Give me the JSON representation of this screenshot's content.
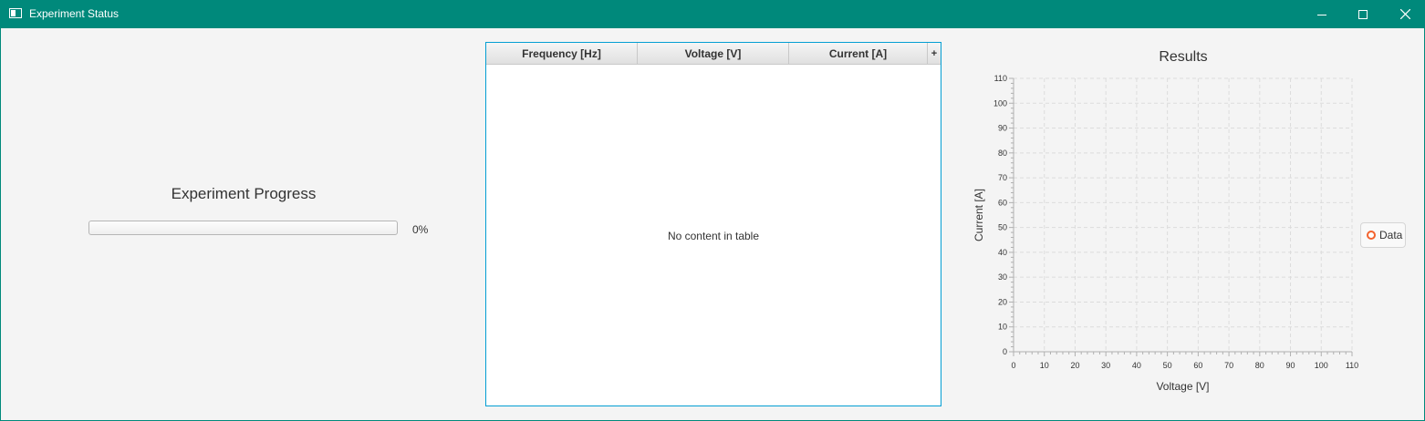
{
  "window": {
    "title": "Experiment Status",
    "controls": [
      "minimize-icon",
      "maximize-icon",
      "close-icon"
    ],
    "accent_color": "#00897b"
  },
  "progress": {
    "title": "Experiment Progress",
    "value": 0,
    "label": "0%"
  },
  "table": {
    "columns": [
      "Frequency [Hz]",
      "Voltage [V]",
      "Current [A]"
    ],
    "menu_button_label": "+",
    "rows": [],
    "placeholder": "No content in table",
    "border_color": "#039ed3"
  },
  "chart_data": {
    "type": "scatter",
    "title": "Results",
    "xlabel": "Voltage [V]",
    "ylabel": "Current [A]",
    "xlim": [
      0,
      110
    ],
    "ylim": [
      0,
      110
    ],
    "xticks": [
      0,
      10,
      20,
      30,
      40,
      50,
      60,
      70,
      80,
      90,
      100,
      110
    ],
    "yticks": [
      0,
      10,
      20,
      30,
      40,
      50,
      60,
      70,
      80,
      90,
      100,
      110
    ],
    "grid": true,
    "legend_position": "right",
    "series": [
      {
        "name": "Data",
        "color": "#f3622d",
        "points": []
      }
    ]
  }
}
